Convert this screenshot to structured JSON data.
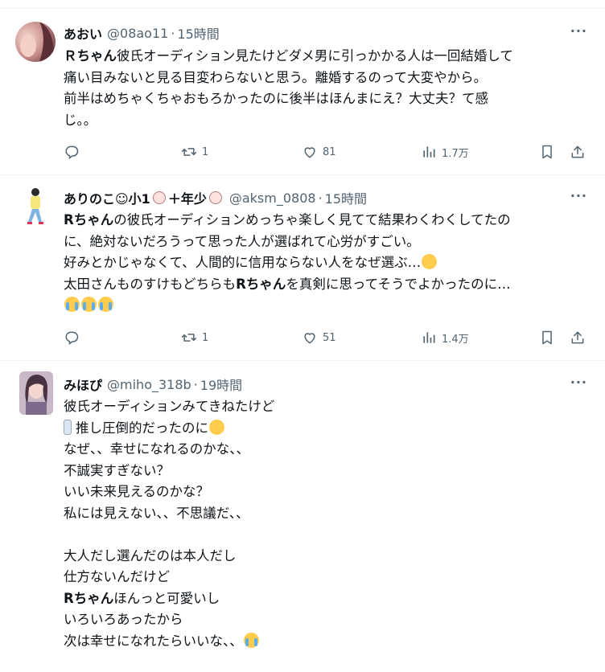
{
  "tweets": [
    {
      "name": "あおい",
      "handle": "@08ao11",
      "time": "15時間",
      "more": "···",
      "lines": [
        [
          {
            "t": "Ｒちゃん",
            "b": true
          },
          {
            "t": "彼氏オーディション見たけどダメ男に引っかかる人は一回結婚して"
          }
        ],
        [
          {
            "t": "痛い目みないと見る目変わらないと思う。離婚するのって大変やから。"
          }
        ],
        [
          {
            "t": "前半はめちゃくちゃおもろかったのに後半はほんまにえ？大丈夫？て感"
          }
        ],
        [
          {
            "t": "じ。。"
          }
        ]
      ],
      "stats": {
        "reply": "",
        "retweet": "1",
        "like": "81",
        "views": "1.7万"
      }
    },
    {
      "name": "ありのこ☺小1",
      "name_suffix": "＋年少",
      "handle": "@aksm_0808",
      "time": "15時間",
      "more": "···",
      "lines": [
        [
          {
            "t": "Rちゃん",
            "b": true
          },
          {
            "t": "の彼氏オーディションめっちゃ楽しく見てて結果わくわくしてたの"
          }
        ],
        [
          {
            "t": "に、絶対ないだろうって思った人が選ばれて心労がすごい。"
          }
        ],
        [
          {
            "t": "好みとかじゃなくて、人間的に信用ならない人をなぜ選ぶ…"
          },
          {
            "emoji": "sad"
          }
        ],
        [
          {
            "t": "太田さんものすけもどちらも"
          },
          {
            "t": "Rちゃん",
            "b": true
          },
          {
            "t": "を真剣に思ってそうでよかったのに…"
          }
        ],
        [
          {
            "emoji": "cry"
          },
          {
            "emoji": "cry"
          },
          {
            "emoji": "cry"
          }
        ]
      ],
      "stats": {
        "reply": "",
        "retweet": "1",
        "like": "51",
        "views": "1.4万"
      }
    },
    {
      "name": "みほぴ",
      "handle": "@miho_318b",
      "time": "19時間",
      "more": "···",
      "lines": [
        [
          {
            "t": "彼氏オーディションみてきねたけど"
          }
        ],
        [
          {
            "emoji": "bottle"
          },
          {
            "t": "推し圧倒的だったのに"
          },
          {
            "emoji": "plead"
          }
        ],
        [
          {
            "t": "なぜ、、幸せになれるのかな、、"
          }
        ],
        [
          {
            "t": "不誠実すぎない？"
          }
        ],
        [
          {
            "t": "いい未来見えるのかな？"
          }
        ],
        [
          {
            "t": "私には見えない、、不思議だ、、"
          }
        ],
        [
          {
            "t": ""
          }
        ],
        [
          {
            "t": "大人だし選んだのは本人だし"
          }
        ],
        [
          {
            "t": "仕方ないんだけど"
          }
        ],
        [
          {
            "t": "Rちゃん",
            "b": true
          },
          {
            "t": "ほんっと可愛いし"
          }
        ],
        [
          {
            "t": "いろいろあったから"
          }
        ],
        [
          {
            "t": "次は幸せになれたらいいな、、"
          },
          {
            "emoji": "cry"
          }
        ]
      ]
    }
  ],
  "colors": {
    "text": "#0f1419",
    "secondary": "#536471",
    "divider": "#eff3f4",
    "emoji_yellow": "#ffcc4d"
  },
  "icons": [
    "reply-icon",
    "retweet-icon",
    "like-icon",
    "views-icon",
    "bookmark-icon",
    "share-icon",
    "more-icon"
  ]
}
